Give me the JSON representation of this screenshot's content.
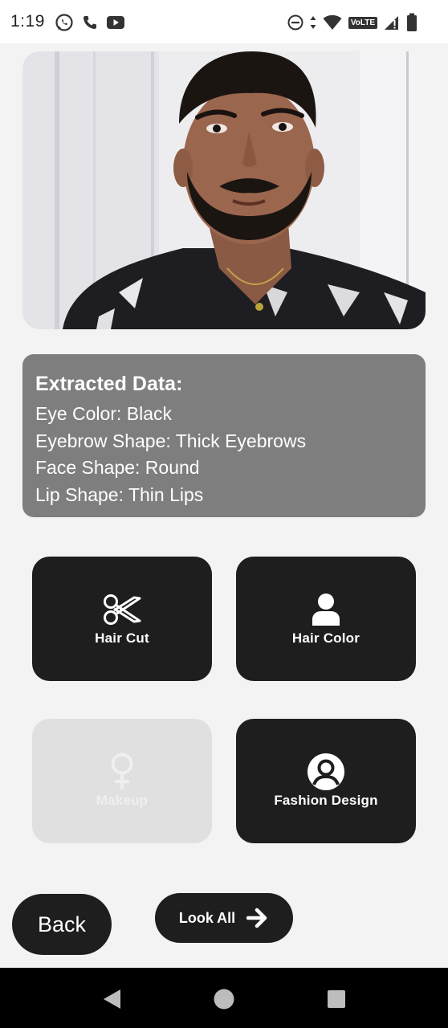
{
  "status_bar": {
    "time": "1:19",
    "left_icons": [
      "whatsapp-icon",
      "phone-icon",
      "youtube-icon"
    ],
    "right_icons": [
      "do-not-disturb-icon",
      "data-arrows-icon",
      "wifi-icon",
      "volte-icon",
      "signal-icon",
      "battery-icon"
    ],
    "volte_label": "VoLTE"
  },
  "photo": {
    "subject": "user-face-photo"
  },
  "extracted": {
    "title": "Extracted Data:",
    "eye_color": "Eye Color: Black",
    "eyebrow_shape": "Eyebrow Shape: Thick Eyebrows",
    "face_shape": "Face Shape: Round",
    "lip_shape": "Lip Shape: Thin Lips"
  },
  "tiles": {
    "hair_cut": {
      "label": "Hair Cut",
      "icon": "scissors-icon",
      "enabled": true
    },
    "hair_color": {
      "label": "Hair Color",
      "icon": "person-icon",
      "enabled": true
    },
    "makeup": {
      "label": "Makeup",
      "icon": "female-symbol-icon",
      "enabled": false
    },
    "fashion_design": {
      "label": "Fashion Design",
      "icon": "user-circle-icon",
      "enabled": true
    }
  },
  "buttons": {
    "back": "Back",
    "look_all": "Look All"
  },
  "colors": {
    "background": "#f3f3f3",
    "tile_dark": "#1e1e1e",
    "tile_disabled": "#e0e0e0",
    "info_card": "#7e7e7e"
  }
}
